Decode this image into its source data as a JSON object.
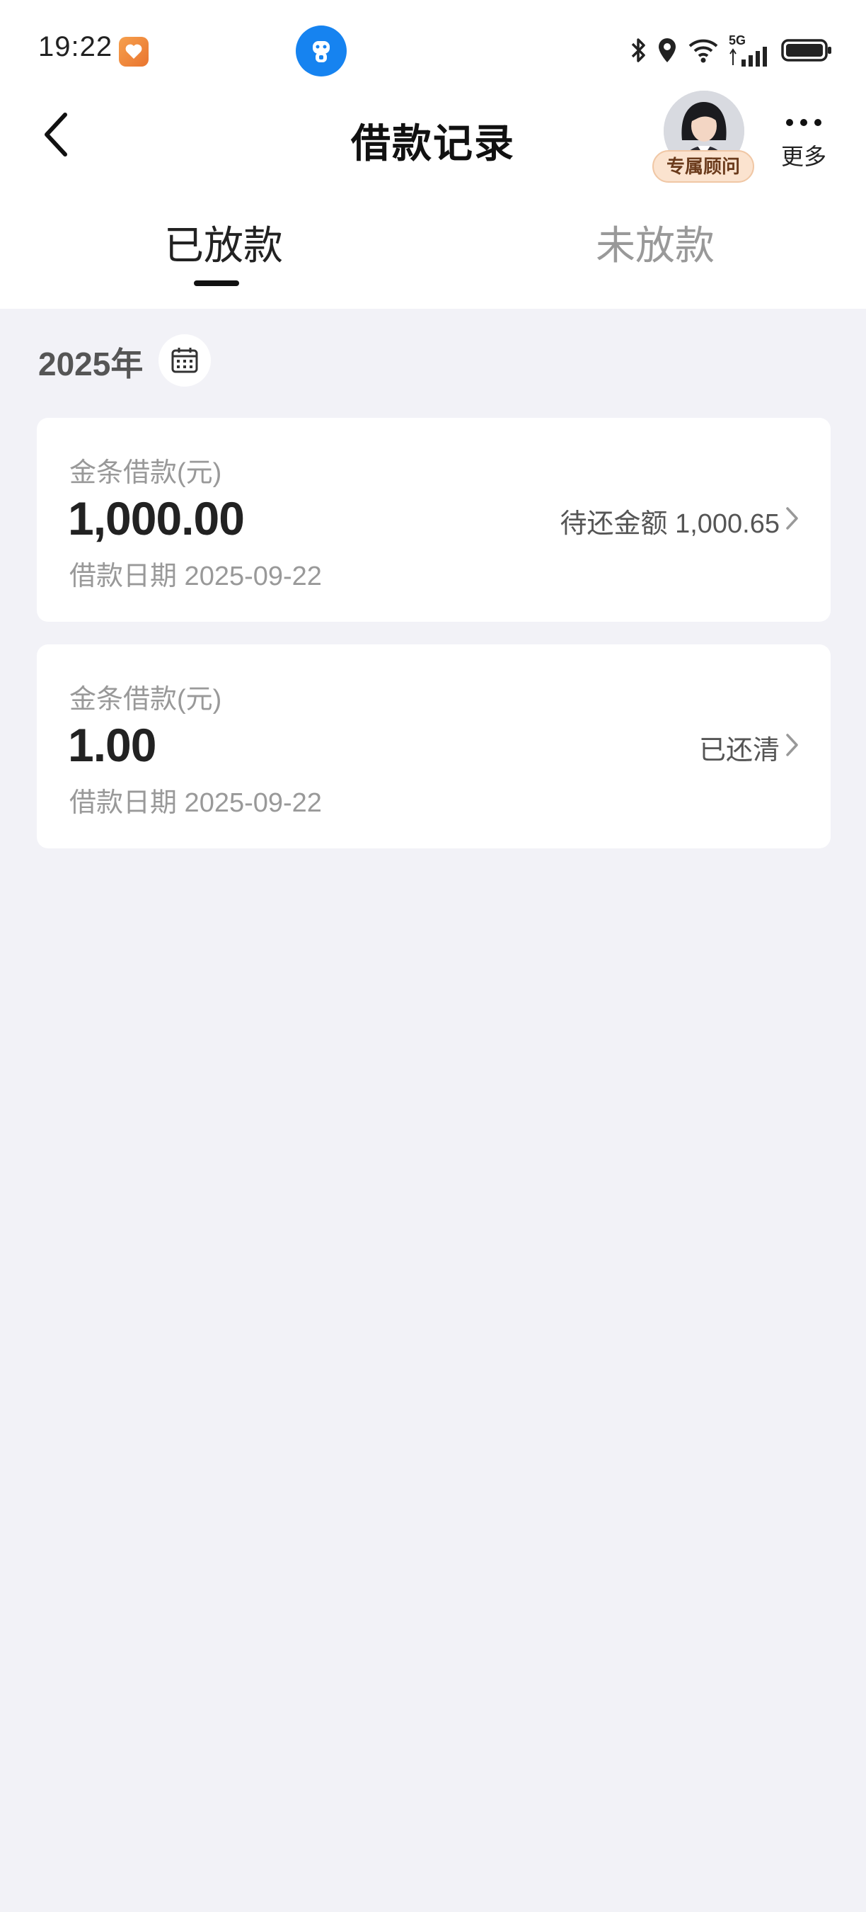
{
  "status_bar": {
    "time": "19:22",
    "network": "5G",
    "icons": [
      "heart-app-icon",
      "mascot-app-icon",
      "bluetooth-icon",
      "location-icon",
      "wifi-icon",
      "signal-icon",
      "battery-icon"
    ]
  },
  "nav": {
    "title": "借款记录",
    "advisor_badge": "专属顾问",
    "more_label": "更多"
  },
  "tabs": [
    {
      "label": "已放款",
      "active": true
    },
    {
      "label": "未放款",
      "active": false
    }
  ],
  "year": "2025年",
  "records": [
    {
      "label": "金条借款(元)",
      "amount": "1,000.00",
      "date": "借款日期 2025-09-22",
      "status": "待还金额 1,000.65"
    },
    {
      "label": "金条借款(元)",
      "amount": "1.00",
      "date": "借款日期 2025-09-22",
      "status": "已还清"
    }
  ],
  "colors": {
    "background": "#f2f2f7",
    "card": "#ffffff",
    "accent_blue": "#1683f0",
    "badge_bg": "#fbe3cf",
    "text_primary": "#222222",
    "text_secondary": "#999999"
  }
}
